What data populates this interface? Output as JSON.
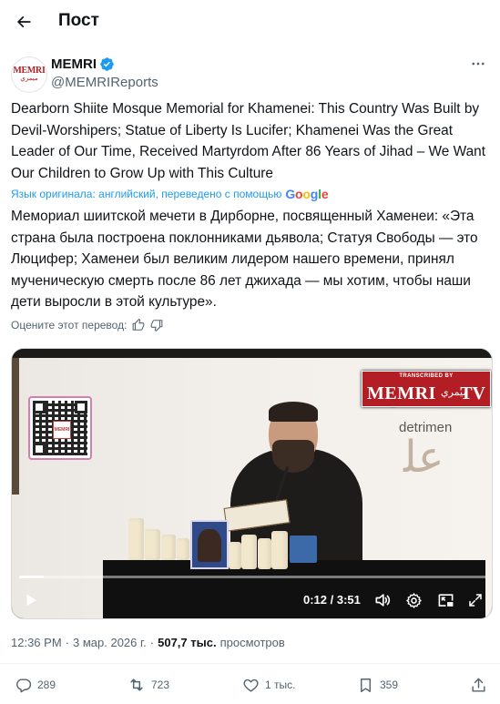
{
  "header": {
    "title": "Пост",
    "back_icon": "arrow-left-icon"
  },
  "author": {
    "name": "MEMRI",
    "handle": "@MEMRIReports",
    "verified": true,
    "avatar_logo": "MEMRI",
    "avatar_logo_sub": "ميمري"
  },
  "tweet": {
    "text": "Dearborn Shiite Mosque Memorial for Khamenei: This Country Was Built by Devil-Worshipers; Statue of Liberty Is Lucifer; Khamenei Was the Great Leader of Our Time, Received Martyrdom After 86 Years of Jihad – We Want Our Children to Grow Up with This Culture",
    "translation_note": "Язык оригинала: английский, переведено с помощью",
    "translation_provider": "Google",
    "translated_text": "Мемориал шиитской мечети в Дирборне, посвященный Хаменеи: «Эта страна была построена поклонниками дьявола; Статуя Свободы — это Люцифер; Хаменеи был великим лидером нашего времени, принял мученическую смерть после 86 лет джихада — мы хотим, чтобы наши дети выросли в этой культуре».",
    "rate_label": "Оцените этот перевод:"
  },
  "video": {
    "overlay_word": "detrimen",
    "logo_transcribed": "TRANSCRIBED BY",
    "logo_main": "MEMRI",
    "logo_arabic": "ميمري",
    "logo_tv": "TV",
    "qr_logo": "MEMRI",
    "current_time": "0:12",
    "duration": "3:51",
    "time_display": "0:12 / 3:51",
    "progress_fraction": 0.052
  },
  "meta": {
    "time": "12:36 PM",
    "date": "3 мар. 2026 г.",
    "separator": "·",
    "views_count": "507,7 тыс.",
    "views_label": "просмотров"
  },
  "actions": {
    "replies": "289",
    "reposts": "723",
    "likes": "1 тыс.",
    "bookmarks": "359"
  },
  "colors": {
    "link": "#1d9bf0",
    "secondary_text": "#536471",
    "primary_text": "#0f1419",
    "verified": "#1d9bf0",
    "memri_red": "#b21e23"
  }
}
